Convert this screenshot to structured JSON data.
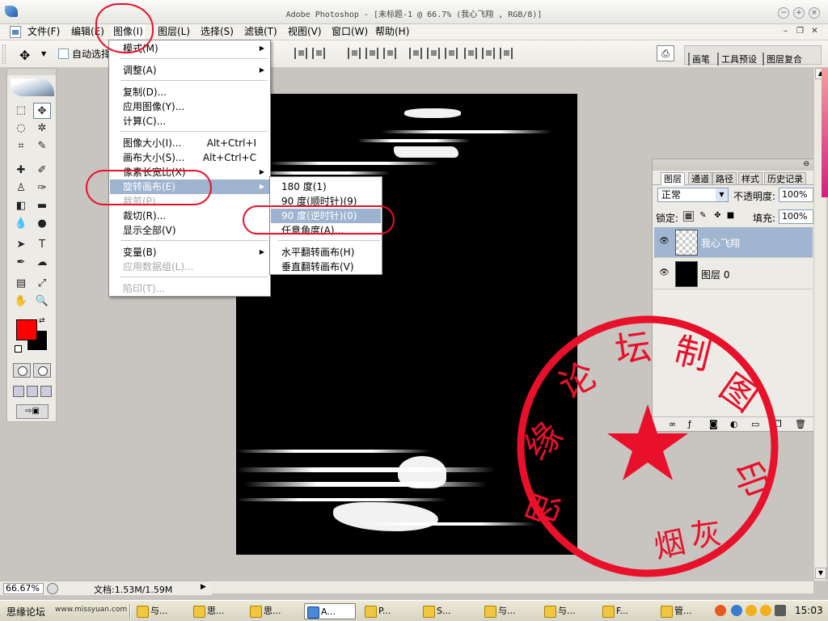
{
  "titlebar": {
    "title": "Adobe Photoshop - [未标题-1 @ 66.7% (我心飞翔  , RGB/8)]"
  },
  "menubar": {
    "items": [
      "文件(F)",
      "编辑(E)",
      "图像(I)",
      "图层(L)",
      "选择(S)",
      "滤镜(T)",
      "视图(V)",
      "窗口(W)",
      "帮助(H)"
    ]
  },
  "options": {
    "auto_select": "自动选择"
  },
  "dock_tabs": [
    "画笔",
    "工具预设",
    "图层复合"
  ],
  "image_menu": {
    "items": [
      {
        "label": "模式(M)",
        "shortcut": "",
        "submenu": true
      },
      {
        "label": "调整(A)",
        "shortcut": "",
        "submenu": true
      },
      {
        "label": "复制(D)...",
        "shortcut": ""
      },
      {
        "label": "应用图像(Y)...",
        "shortcut": ""
      },
      {
        "label": "计算(C)...",
        "shortcut": ""
      },
      {
        "label": "图像大小(I)...",
        "shortcut": "Alt+Ctrl+I"
      },
      {
        "label": "画布大小(S)...",
        "shortcut": "Alt+Ctrl+C"
      },
      {
        "label": "像素长宽比(X)",
        "shortcut": "",
        "submenu": true
      },
      {
        "label": "旋转画布(E)",
        "shortcut": "",
        "submenu": true,
        "highlighted": true
      },
      {
        "label": "裁剪(P)",
        "shortcut": "",
        "disabled": true
      },
      {
        "label": "裁切(R)...",
        "shortcut": ""
      },
      {
        "label": "显示全部(V)",
        "shortcut": ""
      },
      {
        "label": "变量(B)",
        "shortcut": "",
        "submenu": true
      },
      {
        "label": "应用数据组(L)...",
        "shortcut": "",
        "disabled": true
      },
      {
        "label": "陷印(T)...",
        "shortcut": "",
        "disabled": true
      }
    ]
  },
  "rotate_submenu": {
    "items": [
      {
        "label": "180 度(1)"
      },
      {
        "label": "90 度(顺时针)(9)"
      },
      {
        "label": "90 度(逆时针)(0)",
        "highlighted": true
      },
      {
        "label": "任意角度(A)..."
      },
      {
        "label": "水平翻转画布(H)"
      },
      {
        "label": "垂直翻转画布(V)"
      }
    ]
  },
  "layers_panel": {
    "tabs": [
      "图层",
      "通道",
      "路径",
      "样式",
      "历史记录"
    ],
    "blend_mode": "正常",
    "opacity_label": "不透明度:",
    "opacity": "100%",
    "lock_label": "锁定:",
    "fill_label": "填充:",
    "fill": "100%",
    "layers": [
      {
        "name": "我心飞翔",
        "selected": true
      },
      {
        "name": "图层 0",
        "selected": false
      }
    ]
  },
  "statusbar": {
    "zoom": "66.67%",
    "doc_info": "文档:1.53M/1.59M"
  },
  "stamp": {
    "outer_text": "思缘论坛制图",
    "inner_text": "烟灰",
    "color": "#e8102a"
  },
  "taskbar": {
    "start_label": "思缘论坛",
    "site": "www.missyuan.com",
    "tasks": [
      "与...",
      "思...",
      "思...",
      "A...",
      "P...",
      "S...",
      "与...",
      "与...",
      "F...",
      "管..."
    ],
    "clock": "15:03"
  },
  "colors": {
    "foreground": "#ff0000",
    "background": "#000000",
    "highlight": "#9db3cf"
  }
}
